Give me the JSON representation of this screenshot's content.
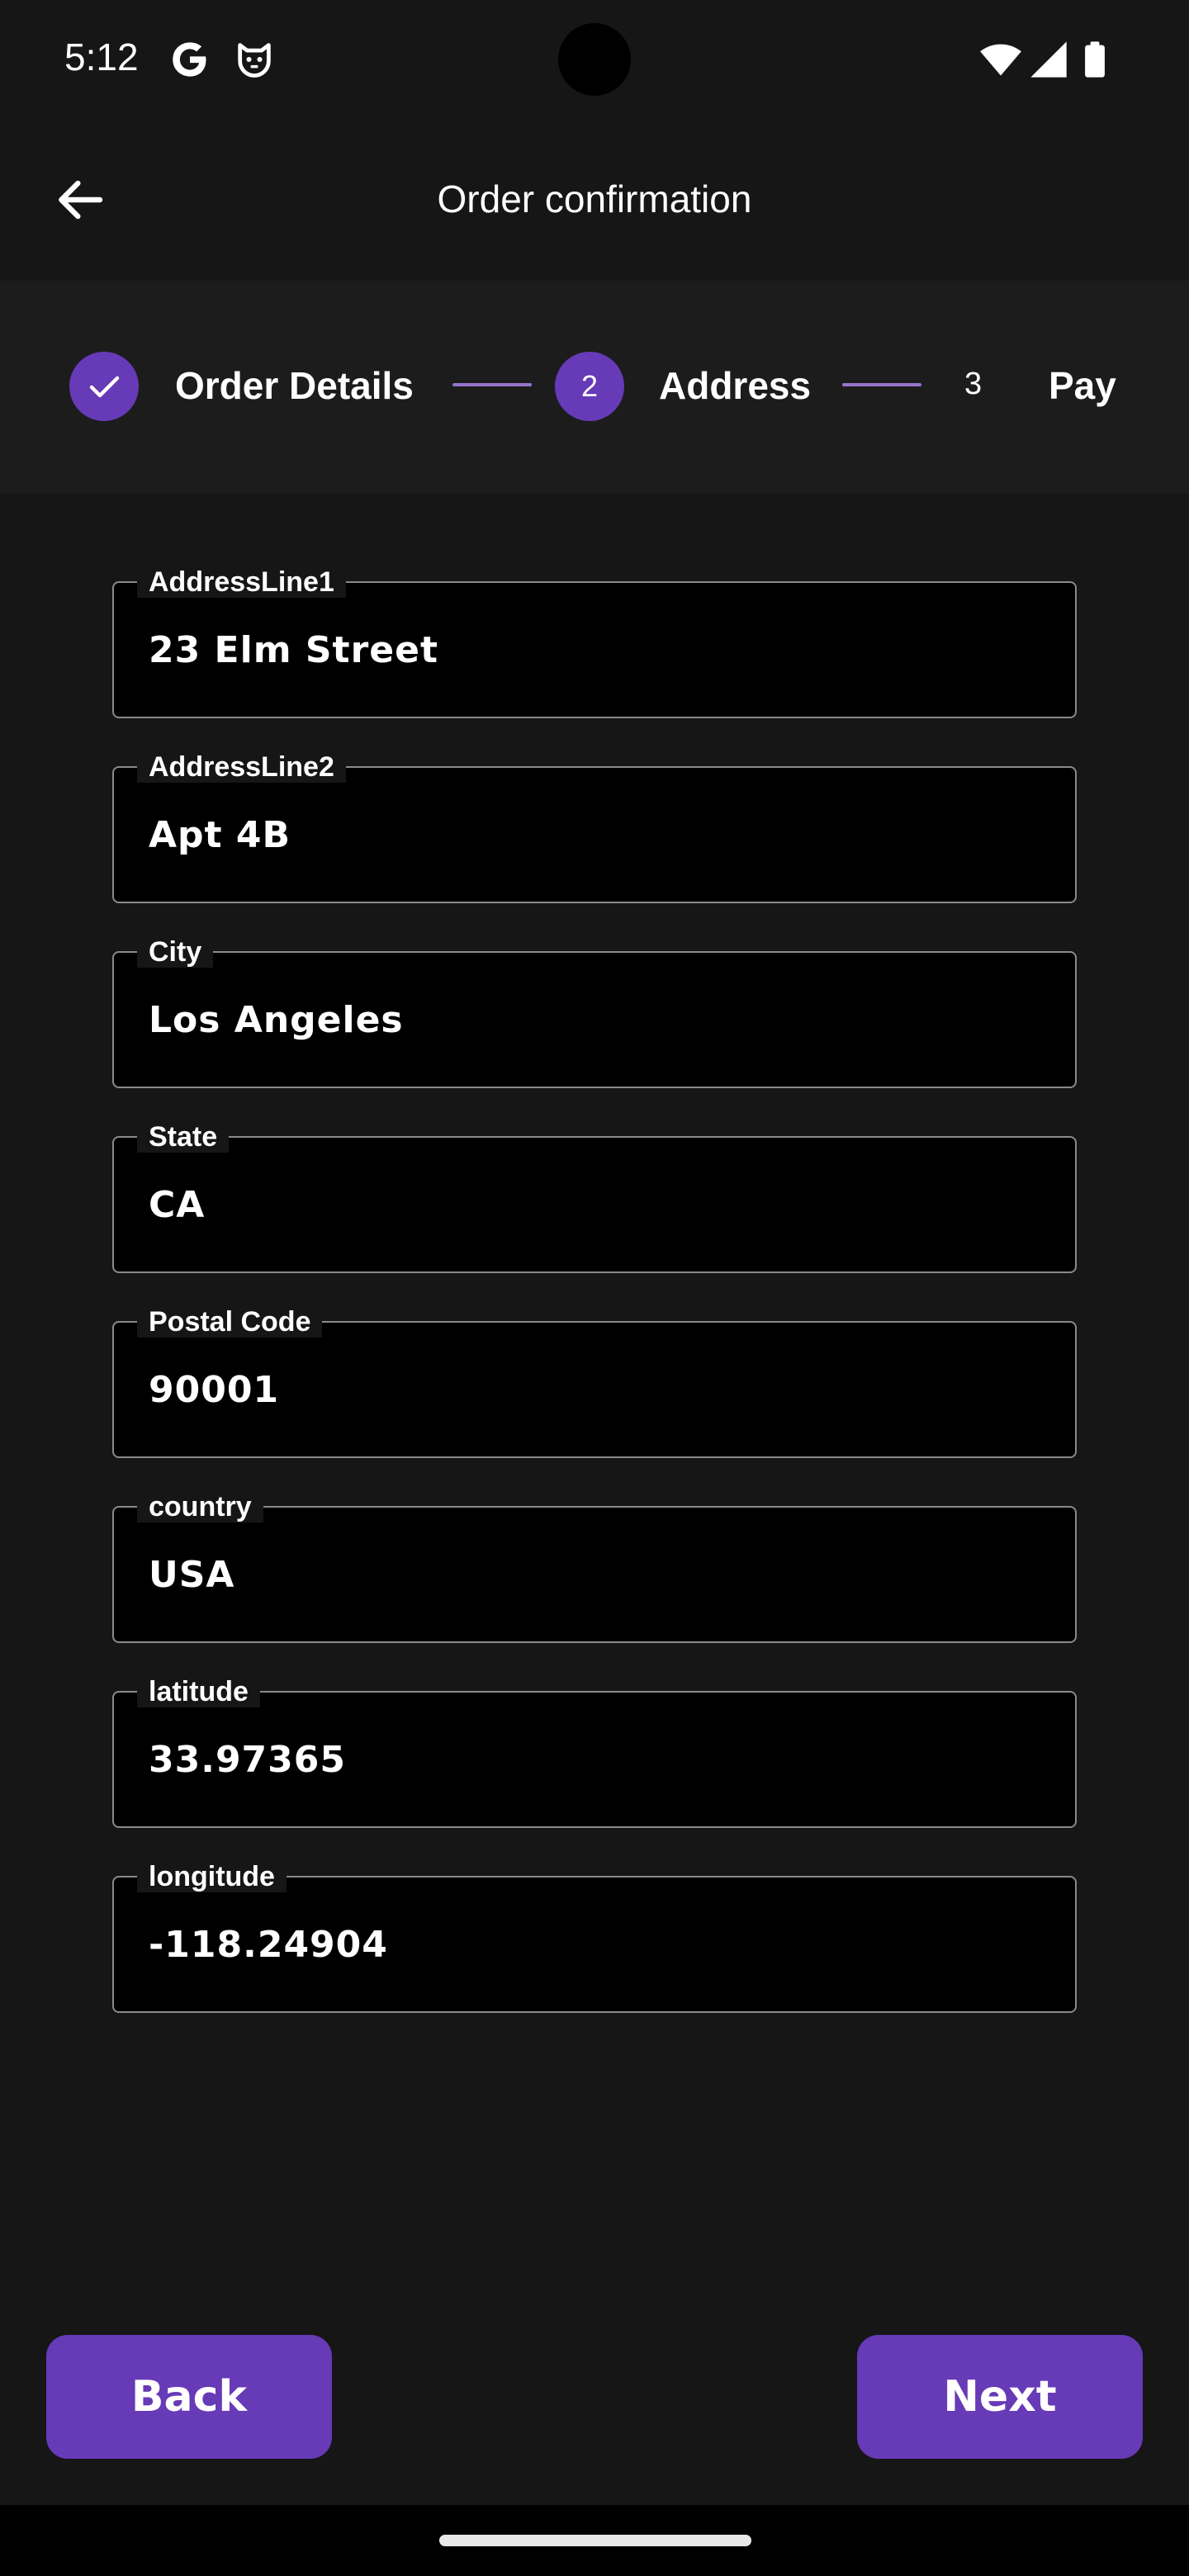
{
  "status_bar": {
    "time": "5:12",
    "icons": [
      "google-icon",
      "cat-face-icon",
      "wifi-icon",
      "signal-icon",
      "battery-icon"
    ]
  },
  "app_bar": {
    "title": "Order confirmation",
    "back_icon": "arrow-left-icon"
  },
  "stepper": {
    "steps": [
      {
        "label": "Order Details",
        "indicator": "check-icon",
        "state": "completed"
      },
      {
        "label": "Address",
        "number": "2",
        "state": "active"
      },
      {
        "label": "Pay",
        "number": "3",
        "state": "upcoming"
      }
    ]
  },
  "form": {
    "fields": [
      {
        "label": "AddressLine1",
        "value": "23 Elm Street"
      },
      {
        "label": "AddressLine2",
        "value": "Apt 4B"
      },
      {
        "label": "City",
        "value": "Los Angeles"
      },
      {
        "label": "State",
        "value": "CA"
      },
      {
        "label": "Postal Code",
        "value": "90001"
      },
      {
        "label": "country",
        "value": "USA"
      },
      {
        "label": "latitude",
        "value": "33.97365"
      },
      {
        "label": "longitude",
        "value": "-118.24904"
      }
    ]
  },
  "actions": {
    "back_label": "Back",
    "next_label": "Next"
  },
  "colors": {
    "accent": "#673ab7",
    "connector": "#9575cd",
    "background": "#161616",
    "field_background": "#000000"
  }
}
